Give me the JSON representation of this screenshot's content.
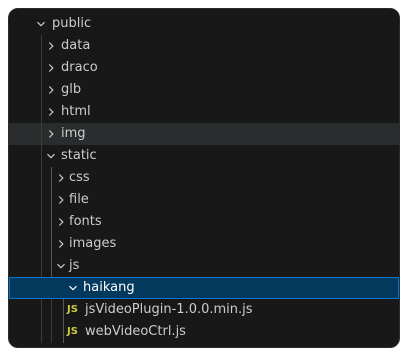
{
  "explorer": {
    "root": {
      "label": "public",
      "expanded": true
    },
    "public_children": [
      {
        "label": "data",
        "expanded": false
      },
      {
        "label": "draco",
        "expanded": false
      },
      {
        "label": "glb",
        "expanded": false
      },
      {
        "label": "html",
        "expanded": false
      },
      {
        "label": "img",
        "expanded": false
      }
    ],
    "static": {
      "label": "static",
      "expanded": true
    },
    "static_children": [
      {
        "label": "css",
        "expanded": false
      },
      {
        "label": "file",
        "expanded": false
      },
      {
        "label": "fonts",
        "expanded": false
      },
      {
        "label": "images",
        "expanded": false
      }
    ],
    "js_folder": {
      "label": "js",
      "expanded": true
    },
    "haikang_folder": {
      "label": "haikang",
      "expanded": true,
      "selected": true
    },
    "files": [
      {
        "label": "jsVideoPlugin-1.0.0.min.js",
        "icon": "JS"
      },
      {
        "label": "webVideoCtrl.js",
        "icon": "JS"
      }
    ]
  },
  "colors": {
    "background": "#181818",
    "text": "#cccccc",
    "selected_bg": "#04395e",
    "selected_border": "#0078d4",
    "js_icon": "#cbcb41",
    "hover_bg": "#2a2d2e"
  },
  "icons": {
    "expanded": "chevron-down-icon",
    "collapsed": "chevron-right-icon",
    "js_file": "js-file-icon"
  }
}
